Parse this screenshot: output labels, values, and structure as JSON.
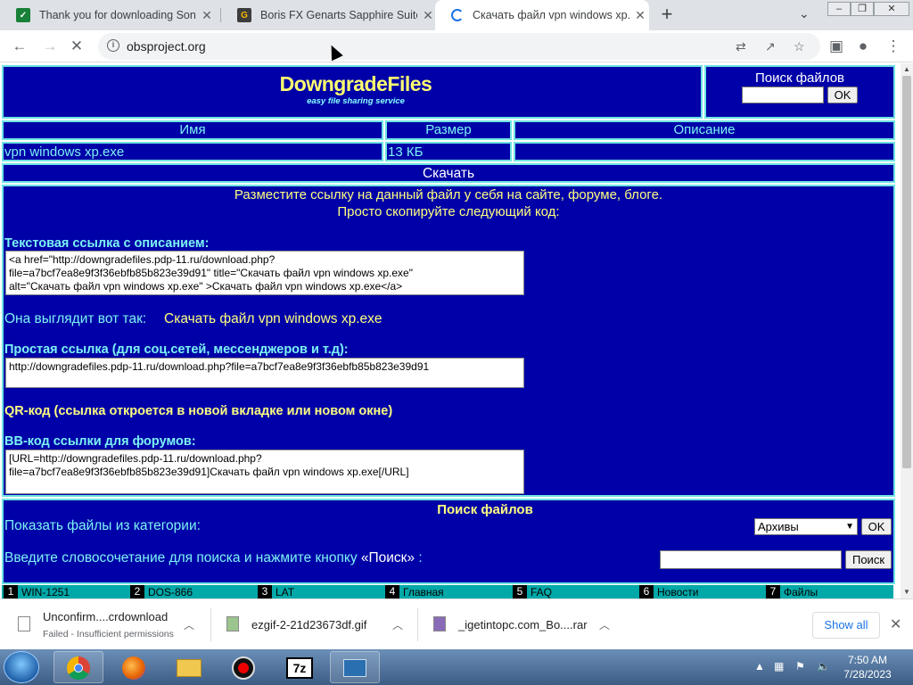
{
  "browser": {
    "tabs": [
      {
        "title": "Thank you for downloading Sony",
        "fav_color": "#188038",
        "fav_char": "✓"
      },
      {
        "title": "Boris FX Genarts Sapphire Suite",
        "fav_color": "#3c3c3c",
        "fav_char": "G"
      },
      {
        "title": "Скачать файл vpn windows xp.e",
        "active": true
      }
    ],
    "url": "obsproject.org",
    "icons": [
      "back-arrow-icon",
      "forward-arrow-icon",
      "loading-spinner-icon",
      "info-icon",
      "translate-icon",
      "share-icon",
      "star-icon",
      "sidepanel-icon",
      "profile-icon",
      "menu-icon"
    ]
  },
  "site": {
    "logo": "DowngradeFiles",
    "tagline": "easy file sharing service",
    "search_title": "Поиск файлов",
    "ok": "OK"
  },
  "table": {
    "headers": [
      "Имя",
      "Размер",
      "Описание"
    ],
    "row": {
      "name": "vpn windows xp.exe",
      "size": "13 КБ",
      "desc": ""
    },
    "download": "Скачать"
  },
  "share": {
    "intro1": "Разместите ссылку на данный файл у себя на сайте, форуме, блоге.",
    "intro2": "Просто скопируйте следующий код:",
    "text_link_label": "Текстовая ссылка с описанием:",
    "text_link_code": "<a href=\"http://downgradefiles.pdp-11.ru/download.php?\nfile=a7bcf7ea8e9f3f36ebfb85b823e39d91\" title=\"Скачать файл vpn windows xp.exe\"\nalt=\"Скачать файл vpn windows xp.exe\" >Скачать файл vpn windows xp.exe</a>",
    "looks_like": "Она выглядит вот так:",
    "looks_like_link": "Скачать файл vpn windows xp.exe",
    "simple_label": "Простая ссылка (для соц.сетей, мессенджеров и т.д):",
    "simple_code": "http://downgradefiles.pdp-11.ru/download.php?file=a7bcf7ea8e9f3f36ebfb85b823e39d91",
    "qr_label": "QR-код (ссылка откроется в новой вкладке или новом окне)",
    "bb_label": "BB-код ссылки для форумов:",
    "bb_code": "[URL=http://downgradefiles.pdp-11.ru/download.php?\nfile=a7bcf7ea8e9f3f36ebfb85b823e39d91]Скачать файл vpn windows xp.exe[/URL]"
  },
  "search": {
    "title": "Поиск файлов",
    "category_label": "Показать файлы из категории:",
    "category_value": "Архивы",
    "ok": "OK",
    "phrase_label": "Введите словосочетание для поиска и нажмите кнопку",
    "phrase_quote": "«Поиск»",
    "phrase_tail": ":",
    "search_button": "Поиск"
  },
  "bottom_nav": [
    {
      "num": "1",
      "label": "WIN-1251"
    },
    {
      "num": "2",
      "label": "DOS-866"
    },
    {
      "num": "3",
      "label": "LAT"
    },
    {
      "num": "4",
      "label": "Главная"
    },
    {
      "num": "5",
      "label": "FAQ"
    },
    {
      "num": "6",
      "label": "Новости"
    },
    {
      "num": "7",
      "label": "Файлы"
    }
  ],
  "downloads": [
    {
      "name": "Unconfirm....crdownload",
      "status": "Failed - Insufficient permissions"
    },
    {
      "name": "ezgif-2-21d23673df.gif",
      "status": ""
    },
    {
      "name": "_igetintopc.com_Bo....rar",
      "status": ""
    }
  ],
  "show_all": "Show all",
  "clock": {
    "time": "7:50 AM",
    "date": "7/28/2023"
  }
}
